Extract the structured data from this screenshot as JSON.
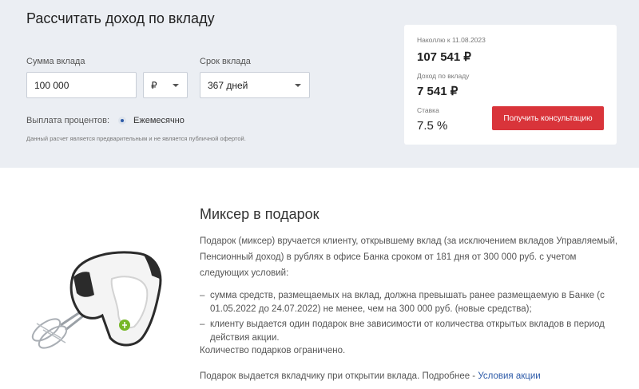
{
  "calculator": {
    "title": "Рассчитать доход по вкладу",
    "amount": {
      "label": "Сумма вклада",
      "value": "100 000"
    },
    "currency": {
      "value": "₽"
    },
    "term": {
      "label": "Срок вклада",
      "value": "367 дней"
    },
    "payout": {
      "label": "Выплата процентов:",
      "option": "Ежемесячно"
    },
    "disclaimer": "Данный расчет является предварительным и не является публичной офертой."
  },
  "summary": {
    "total_label": "Наколлю к 11.08.2023",
    "total_value": "107 541 ₽",
    "income_label": "Доход по вкладу",
    "income_value": "7 541 ₽",
    "rate_label": "Ставка",
    "rate_value": "7.5 %",
    "consult_button": "Получить консультацию",
    "accent_color": "#d9343a"
  },
  "promo": {
    "title": "Миксер в подарок",
    "intro": "Подарок (миксер) вручается клиенту, открывшему вклад (за исключением вкладов Управляемый, Пенсионный доход) в рублях в офисе Банка сроком от 181 дня от 300 000 руб. с учетом следующих условий:",
    "conditions": [
      "сумма средств, размещаемых на вклад, должна превышать ранее размещаемую в Банке (с 01.05.2022 до 24.07.2022) не менее, чем на 300 000 руб. (новые средства);",
      "клиенту выдается один подарок вне зависимости от количества открытых вкладов в период действия акции."
    ],
    "limit": "Количество подарков ограничено.",
    "footer_text": "Подарок выдается вкладчику при открытии вклада. Подробнее - ",
    "footer_link": "Условия акции"
  }
}
